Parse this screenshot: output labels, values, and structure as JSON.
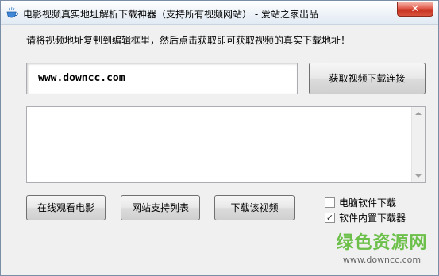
{
  "window": {
    "title": "电影视频真实地址解析下载神器（支持所有视频网站） - 爱站之家出品",
    "close_label": "✕"
  },
  "main": {
    "instruction": "请将视频地址复制到编辑框里，然后点击获取即可获取视频的真实下载地址！",
    "url_input_value": "www.downcc.com",
    "get_button_label": "获取视频下载连接",
    "result_text": ""
  },
  "buttons": {
    "watch_label": "在线观看电影",
    "list_label": "网站支持列表",
    "download_label": "下载该视频"
  },
  "options": {
    "pc_download_label": "电脑软件下载",
    "pc_download_checked": false,
    "builtin_downloader_label": "软件内置下载器",
    "builtin_downloader_checked": true,
    "check_mark": "✓"
  },
  "watermark": {
    "cn": "绿色资源网",
    "url": "www.downcc.com"
  },
  "colors": {
    "watermark_green": "#6cc04a",
    "close_red": "#c7321f"
  },
  "icons": {
    "app": "teacup-icon",
    "close": "close-icon"
  }
}
